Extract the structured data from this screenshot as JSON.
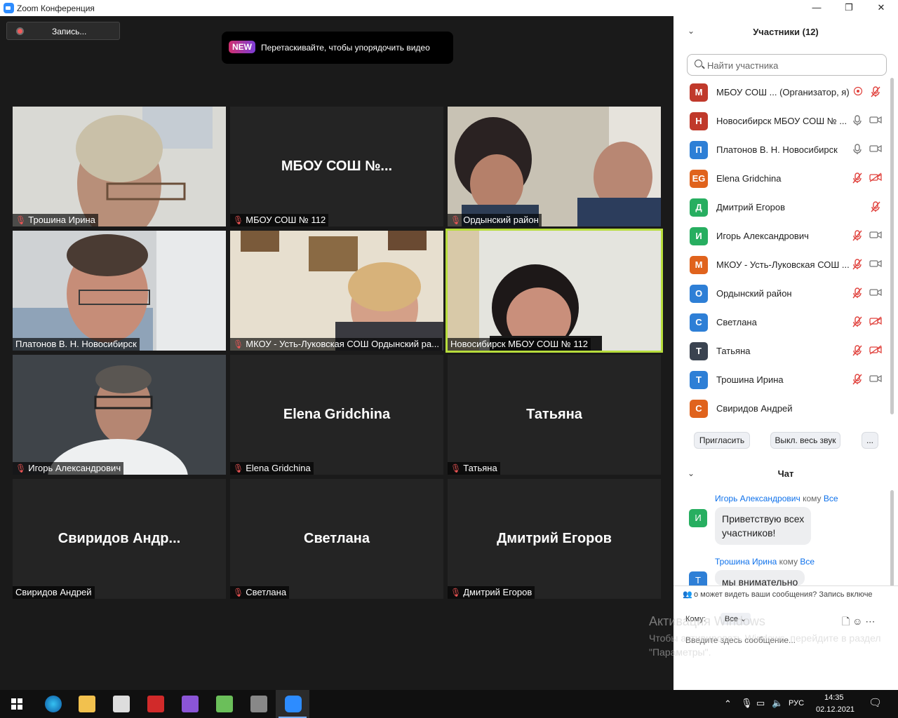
{
  "window": {
    "title": "Zoom Конференция",
    "minimize": "—",
    "maximize": "❐",
    "close": "✕"
  },
  "meeting": {
    "record_label": "Запись...",
    "tip_badge": "NEW",
    "tip_text": "Перетаскивайте, чтобы упорядочить видео",
    "tiles": [
      {
        "id": "t1",
        "label": "Трошина Ирина",
        "muted": true,
        "big": ""
      },
      {
        "id": "t2",
        "label": "МБОУ СОШ № 112",
        "muted": true,
        "big": "МБОУ СОШ №..."
      },
      {
        "id": "t3",
        "label": "Ордынский район",
        "muted": true,
        "big": ""
      },
      {
        "id": "t4",
        "label": "Платонов В.  Н. Новосибирск",
        "muted": false,
        "big": ""
      },
      {
        "id": "t5",
        "label": "МКОУ - Усть-Луковская СОШ Ордынский ра...",
        "muted": true,
        "big": ""
      },
      {
        "id": "t6",
        "label": "Новосибирск МБОУ СОШ № 112",
        "muted": false,
        "big": ""
      },
      {
        "id": "t7",
        "label": "Игорь Александрович",
        "muted": true,
        "big": ""
      },
      {
        "id": "t8",
        "label": "Elena Gridchina",
        "muted": true,
        "big": "Elena Gridchina"
      },
      {
        "id": "t9",
        "label": "Татьяна",
        "muted": true,
        "big": "Татьяна"
      },
      {
        "id": "t10",
        "label": "Свиридов Андрей",
        "muted": false,
        "big": "Свиридов  Андр..."
      },
      {
        "id": "t11",
        "label": "Светлана",
        "muted": true,
        "big": "Светлана"
      },
      {
        "id": "t12",
        "label": "Дмитрий Егоров",
        "muted": true,
        "big": "Дмитрий Егоров"
      }
    ],
    "watermark_title": "Активация Windows",
    "watermark_text": "Чтобы активировать Windows, перейдите в раздел \"Параметры\"."
  },
  "participants": {
    "header": "Участники (12)",
    "search_placeholder": "Найти участника",
    "list": [
      {
        "initial": "М",
        "color": "#c0392b",
        "name": "МБОУ СОШ ...  (Организатор, я)",
        "mic": "muted",
        "cam": "record"
      },
      {
        "initial": "Н",
        "color": "#c0392b",
        "name": "Новосибирск МБОУ СОШ № ...",
        "mic": "on",
        "cam": "on"
      },
      {
        "initial": "П",
        "color": "#2e7fd6",
        "name": "Платонов В.  Н. Новосибирск",
        "mic": "on",
        "cam": "on"
      },
      {
        "initial": "EG",
        "color": "#e0631d",
        "name": "Elena Gridchina",
        "mic": "muted",
        "cam": "off"
      },
      {
        "initial": "Д",
        "color": "#27ae60",
        "name": "Дмитрий Егоров",
        "mic": "muted",
        "cam": "none"
      },
      {
        "initial": "И",
        "color": "#27ae60",
        "name": "Игорь Александрович",
        "mic": "muted",
        "cam": "on"
      },
      {
        "initial": "М",
        "color": "#e0631d",
        "name": "МКОУ - Усть-Луковская СОШ ...",
        "mic": "muted",
        "cam": "on"
      },
      {
        "initial": "О",
        "color": "#2e7fd6",
        "name": "Ордынский район",
        "mic": "muted",
        "cam": "on"
      },
      {
        "initial": "С",
        "color": "#2e7fd6",
        "name": "Светлана",
        "mic": "muted",
        "cam": "off"
      },
      {
        "initial": "Т",
        "color": "#3a4350",
        "name": "Татьяна",
        "mic": "muted",
        "cam": "off"
      },
      {
        "initial": "Т",
        "color": "#2e7fd6",
        "name": "Трошина Ирина",
        "mic": "muted",
        "cam": "on"
      },
      {
        "initial": "С",
        "color": "#e0631d",
        "name": "Свиридов Андрей",
        "mic": "none",
        "cam": "none"
      }
    ],
    "invite_label": "Пригласить",
    "mute_all_label": "Выкл. весь звук",
    "more_label": "..."
  },
  "chat": {
    "header": "Чат",
    "messages": [
      {
        "initial": "И",
        "color": "#27ae60",
        "from": "Игорь Александрович",
        "to_word": "кому",
        "to": "Все",
        "text_line1": "Приветствую всех",
        "text_line2": "участников!"
      },
      {
        "initial": "Т",
        "color": "#2e7fd6",
        "from": "Трошина Ирина",
        "to_word": "кому",
        "to": "Все",
        "text_line1": "мы внимательно",
        "text_line2": ""
      }
    ],
    "notice": "о может видеть ваши сообщения? Запись включе",
    "to_label": "Кому:",
    "to_value": "Все",
    "input_placeholder": "Введите здесь сообщение..."
  },
  "taskbar": {
    "lang": "РУС",
    "time": "14:35",
    "date": "02.12.2021"
  }
}
